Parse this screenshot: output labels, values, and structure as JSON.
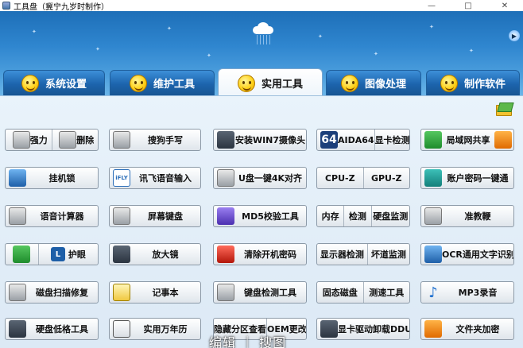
{
  "window": {
    "title": "工具盘（冀宁九岁时制作）",
    "minimize": "—",
    "maximize": "□",
    "close": "✕"
  },
  "tabs": [
    {
      "label": "系统设置",
      "active": false
    },
    {
      "label": "维护工具",
      "active": false
    },
    {
      "label": "实用工具",
      "active": true
    },
    {
      "label": "图像处理",
      "active": false
    },
    {
      "label": "制作软件",
      "active": false
    }
  ],
  "buttons": {
    "r1": {
      "b1": {
        "left": "强力",
        "right": "删除"
      },
      "b2": "搜狗手写",
      "b3": "安装WIN7摄像头",
      "b4": {
        "badge": "64",
        "left": "AIDA64",
        "right": "显卡检测"
      },
      "b5": "局域网共享"
    },
    "r2": {
      "b1": "挂机锁",
      "b2": "讯飞语音输入",
      "b3": "U盘一键4K对齐",
      "b4": {
        "left": "CPU-Z",
        "right": "GPU-Z"
      },
      "b5": "账户密码一键通"
    },
    "r3": {
      "b1": "语音计算器",
      "b2": "屏幕键盘",
      "b3": "MD5校验工具",
      "b4": {
        "a": "内存",
        "b": "检测",
        "c": "硬盘监测"
      },
      "b5": "准教鞭"
    },
    "r4": {
      "b1": "护眼",
      "b2": "放大镜",
      "b3": "清除开机密码",
      "b4": {
        "left": "显示器检测",
        "right": "坏道监测"
      },
      "b5": "OCR通用文字识别"
    },
    "r5": {
      "b1": "磁盘扫描修复",
      "b2": "记事本",
      "b3": "键盘检测工具",
      "b4": {
        "left": "固态磁盘",
        "right": "测速工具"
      },
      "b5": "MP3录音"
    },
    "r6": {
      "b1": "硬盘低格工具",
      "b2": "实用万年历",
      "b3": {
        "left": "隐藏分区查看",
        "right": "OEM更改"
      },
      "b4": "显卡驱动卸载DDU",
      "b5": "文件夹加密"
    }
  },
  "icons": {
    "b2_r2_badge": "iFLY",
    "b1_r4_badge": "L"
  },
  "watermark": "编辑 ｜ 搜图"
}
